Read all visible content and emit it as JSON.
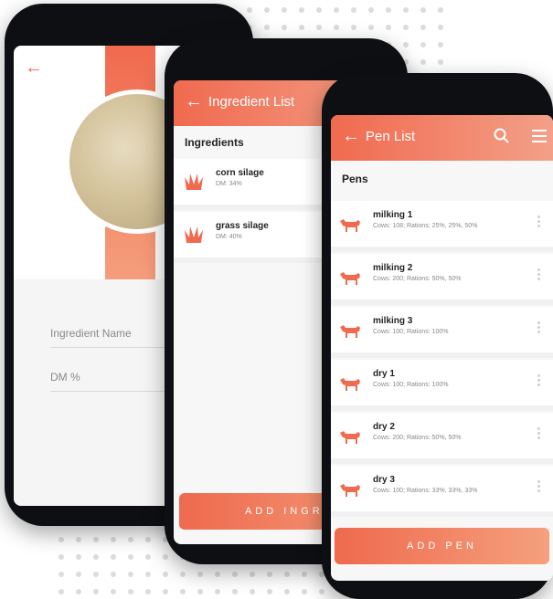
{
  "phone1": {
    "form": {
      "ingredient_name_placeholder": "Ingredient Name",
      "dm_placeholder": "DM %"
    }
  },
  "phone2": {
    "header_title": "Ingredient List",
    "section_title": "Ingredients",
    "items": [
      {
        "name": "corn silage",
        "detail": "DM: 34%"
      },
      {
        "name": "grass silage",
        "detail": "DM: 40%"
      }
    ],
    "add_button": "ADD INGREDI"
  },
  "phone3": {
    "header_title": "Pen List",
    "section_title": "Pens",
    "items": [
      {
        "name": "milking 1",
        "detail": "Cows: 108; Rations: 25%, 25%, 50%"
      },
      {
        "name": "milking 2",
        "detail": "Cows: 200; Rations: 50%, 50%"
      },
      {
        "name": "milking 3",
        "detail": "Cows: 100; Rations: 100%"
      },
      {
        "name": "dry 1",
        "detail": "Cows: 100; Rations: 100%"
      },
      {
        "name": "dry 2",
        "detail": "Cows: 200; Rations: 50%, 50%"
      },
      {
        "name": "dry 3",
        "detail": "Cows: 100; Rations: 33%, 33%, 33%"
      }
    ],
    "add_button": "ADD PEN"
  },
  "colors": {
    "accent": "#f06a4f",
    "accent_light": "#f5a07d"
  },
  "icons": [
    "back-arrow-icon",
    "search-icon",
    "menu-icon",
    "grass-icon",
    "cow-icon",
    "more-vertical-icon"
  ]
}
